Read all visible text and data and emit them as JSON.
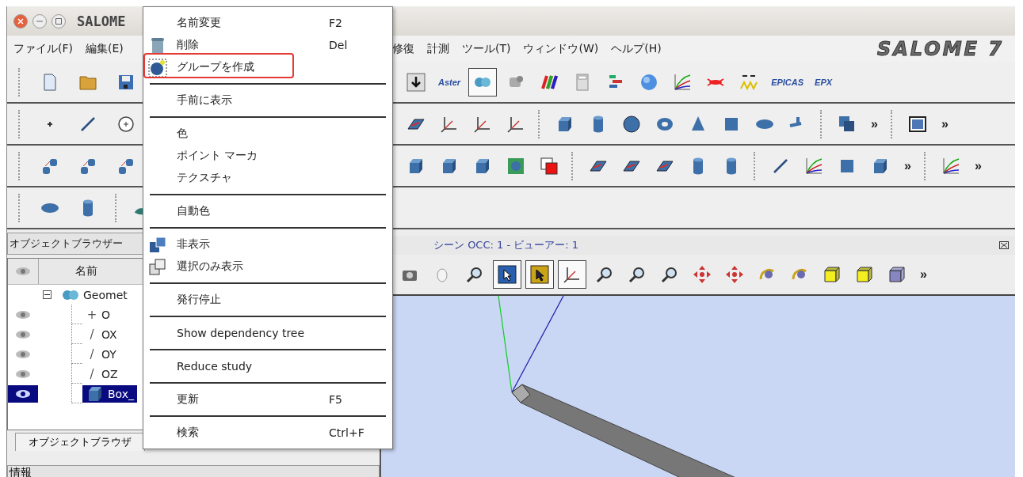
{
  "window": {
    "title": "SALOME",
    "logo": "SALOME 7"
  },
  "menubar": {
    "left": [
      "ファイル(F)",
      "編集(E)"
    ],
    "right": [
      "修復",
      "計測",
      "ツール(T)",
      "ウィンドウ(W)",
      "ヘルプ(H)"
    ]
  },
  "toolbars": [
    {
      "left": [
        {
          "kind": "doc"
        },
        {
          "kind": "folder"
        },
        {
          "kind": "save"
        }
      ],
      "right": [
        {
          "kind": "arrow",
          "selected": false
        },
        {
          "kind": "label",
          "label": "Aster",
          "selected": false
        },
        {
          "kind": "module",
          "selected": true
        },
        {
          "kind": "gear",
          "selected": false
        },
        {
          "kind": "bars",
          "selected": false
        },
        {
          "kind": "calc",
          "selected": false
        },
        {
          "kind": "blocks",
          "selected": false
        },
        {
          "kind": "globe",
          "selected": false
        },
        {
          "kind": "curves",
          "selected": false
        },
        {
          "kind": "crab",
          "selected": false
        },
        {
          "kind": "wave",
          "selected": false
        },
        {
          "kind": "label",
          "label": "EPICAS",
          "selected": false
        },
        {
          "kind": "label",
          "label": "EPX",
          "selected": false
        }
      ]
    },
    {
      "left": [
        {
          "kind": "point"
        },
        {
          "kind": "line"
        },
        {
          "kind": "circle"
        }
      ],
      "right": [
        {
          "kind": "plane",
          "selected": false
        },
        {
          "kind": "axes",
          "selected": false
        },
        {
          "kind": "axes",
          "selected": false
        },
        {
          "kind": "axes",
          "selected": false
        },
        {
          "kind": "sep"
        },
        {
          "kind": "box",
          "selected": false
        },
        {
          "kind": "cylinder",
          "selected": false
        },
        {
          "kind": "sphere",
          "selected": false
        },
        {
          "kind": "torus",
          "selected": false
        },
        {
          "kind": "cone",
          "selected": false
        },
        {
          "kind": "square",
          "selected": false
        },
        {
          "kind": "ellipse",
          "selected": false
        },
        {
          "kind": "tee",
          "selected": false
        },
        {
          "kind": "sep"
        },
        {
          "kind": "stack",
          "selected": false
        },
        {
          "kind": "more",
          "label": "»"
        },
        {
          "kind": "sep"
        },
        {
          "kind": "image",
          "selected": false
        },
        {
          "kind": "more",
          "label": "»"
        }
      ]
    },
    {
      "left": [
        {
          "kind": "shapes"
        },
        {
          "kind": "shapes"
        },
        {
          "kind": "shapes"
        }
      ],
      "right": [
        {
          "kind": "box",
          "selected": false
        },
        {
          "kind": "box",
          "selected": false
        },
        {
          "kind": "box",
          "selected": false
        },
        {
          "kind": "green",
          "selected": false
        },
        {
          "kind": "redsquare",
          "selected": false
        },
        {
          "kind": "sep"
        },
        {
          "kind": "plane",
          "selected": false
        },
        {
          "kind": "plane",
          "selected": false
        },
        {
          "kind": "plane",
          "selected": false
        },
        {
          "kind": "cylinder",
          "selected": false
        },
        {
          "kind": "cylinder",
          "selected": false
        },
        {
          "kind": "sep"
        },
        {
          "kind": "line",
          "selected": false
        },
        {
          "kind": "curves",
          "selected": false
        },
        {
          "kind": "square",
          "selected": false
        },
        {
          "kind": "box",
          "selected": false
        },
        {
          "kind": "more",
          "label": "»"
        },
        {
          "kind": "sep"
        },
        {
          "kind": "curves",
          "selected": false
        },
        {
          "kind": "more",
          "label": "»"
        }
      ]
    },
    {
      "left": [
        {
          "kind": "ellipse"
        },
        {
          "kind": "cylinder"
        },
        {
          "kind": "sep"
        },
        {
          "kind": "surface"
        }
      ]
    }
  ],
  "object_browser": {
    "title": "オブジェクトブラウザー",
    "column": "名前",
    "root": {
      "label": "Geomet",
      "expanded": true,
      "children": [
        {
          "label": "O",
          "glyph": "+",
          "visible": true,
          "selected": false
        },
        {
          "label": "OX",
          "glyph": "/",
          "visible": true,
          "selected": false
        },
        {
          "label": "OY",
          "glyph": "/",
          "visible": true,
          "selected": false
        },
        {
          "label": "OZ",
          "glyph": "/",
          "visible": true,
          "selected": false
        },
        {
          "label": "Box_",
          "visible": true,
          "selected": true
        }
      ]
    },
    "tab": "オブジェクトブラウザ"
  },
  "info_panel": {
    "title": "情報"
  },
  "viewer": {
    "title": "シーン OCC: 1 - ビューアー: 1",
    "tools": [
      {
        "kind": "camera",
        "selected": false
      },
      {
        "kind": "mouse",
        "selected": false
      },
      {
        "kind": "zoom",
        "selected": false
      },
      {
        "kind": "pointer-blue",
        "selected": true
      },
      {
        "kind": "pointer-yellow",
        "selected": true
      },
      {
        "kind": "axes",
        "selected": true
      },
      {
        "kind": "zoom",
        "selected": false
      },
      {
        "kind": "zoom",
        "selected": false
      },
      {
        "kind": "zoom",
        "selected": false
      },
      {
        "kind": "pan",
        "selected": false
      },
      {
        "kind": "pan",
        "selected": false
      },
      {
        "kind": "rotate",
        "selected": false
      },
      {
        "kind": "rotate",
        "selected": false
      },
      {
        "kind": "cube-yellow",
        "selected": false
      },
      {
        "kind": "cube-yellow",
        "selected": false
      },
      {
        "kind": "cube-purple",
        "selected": false
      },
      {
        "kind": "more",
        "label": "»"
      }
    ]
  },
  "context_menu": [
    {
      "kind": "item",
      "label": "名前変更",
      "shortcut": "F2",
      "highlighted": false
    },
    {
      "kind": "item",
      "label": "削除",
      "shortcut": "Del",
      "highlighted": false
    },
    {
      "kind": "item",
      "label": "グループを作成",
      "highlighted": true
    },
    {
      "kind": "separator"
    },
    {
      "kind": "item",
      "label": "手前に表示",
      "highlighted": false
    },
    {
      "kind": "separator"
    },
    {
      "kind": "item",
      "label": "色",
      "highlighted": false
    },
    {
      "kind": "item",
      "label": "ポイント マーカ",
      "highlighted": false
    },
    {
      "kind": "item",
      "label": "テクスチャ",
      "highlighted": false
    },
    {
      "kind": "separator"
    },
    {
      "kind": "item",
      "label": "自動色",
      "highlighted": false
    },
    {
      "kind": "separator"
    },
    {
      "kind": "item",
      "label": "非表示",
      "highlighted": false
    },
    {
      "kind": "item",
      "label": "選択のみ表示",
      "highlighted": false
    },
    {
      "kind": "separator"
    },
    {
      "kind": "item",
      "label": "発行停止",
      "highlighted": false
    },
    {
      "kind": "separator"
    },
    {
      "kind": "item",
      "label": "Show dependency tree",
      "highlighted": false
    },
    {
      "kind": "separator"
    },
    {
      "kind": "item",
      "label": "Reduce study",
      "highlighted": false
    },
    {
      "kind": "separator"
    },
    {
      "kind": "item",
      "label": "更新",
      "shortcut": "F5",
      "highlighted": false
    },
    {
      "kind": "separator"
    },
    {
      "kind": "item",
      "label": "検索",
      "shortcut": "Ctrl+F",
      "highlighted": false
    }
  ]
}
